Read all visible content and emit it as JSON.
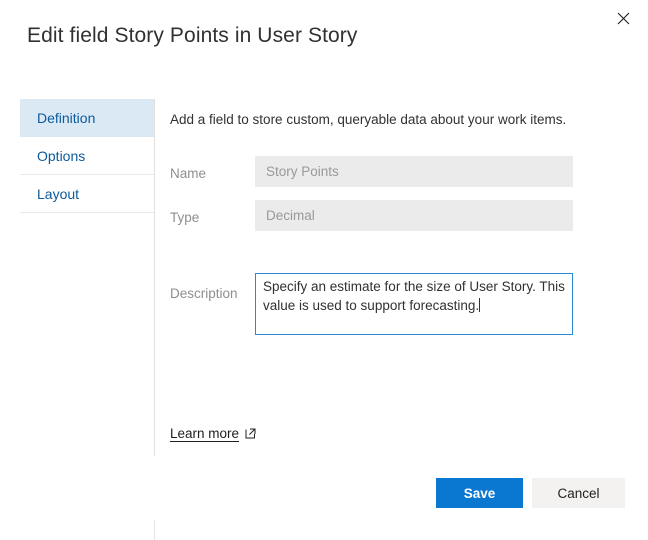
{
  "dialog": {
    "title": "Edit field Story Points in User Story",
    "close_icon": "close-icon"
  },
  "tabs": [
    {
      "label": "Definition",
      "selected": true
    },
    {
      "label": "Options",
      "selected": false
    },
    {
      "label": "Layout",
      "selected": false
    }
  ],
  "content": {
    "intro": "Add a field to store custom, queryable data about your work items.",
    "fields": {
      "name": {
        "label": "Name",
        "value": "Story Points",
        "disabled": true
      },
      "type": {
        "label": "Type",
        "value": "Decimal",
        "disabled": true
      },
      "description": {
        "label": "Description",
        "value": "Specify an estimate for the size of User Story. This value is used to support forecasting.",
        "focused": true
      }
    },
    "learn_more": {
      "label": "Learn more",
      "icon": "external-link-icon"
    }
  },
  "footer": {
    "save_label": "Save",
    "cancel_label": "Cancel"
  },
  "colors": {
    "accent": "#0a77d1",
    "tab_selected_bg": "#dbe9f5",
    "tab_text": "#0d5a9c",
    "field_disabled_bg": "#ebebeb",
    "focus_border": "#2b88d8",
    "secondary_btn_bg": "#f3f2f1"
  }
}
